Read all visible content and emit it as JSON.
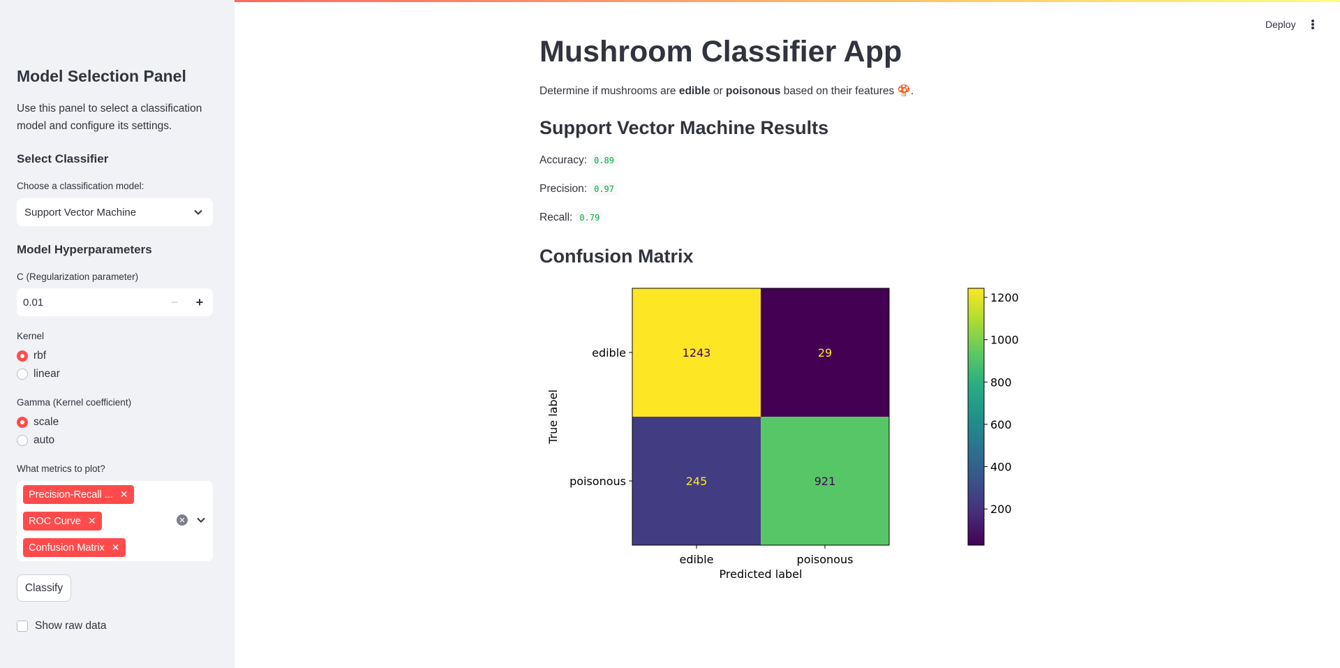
{
  "sidebar": {
    "title": "Model Selection Panel",
    "description": "Use this panel to select a classification model and configure its settings.",
    "select_classifier_heading": "Select Classifier",
    "model_label": "Choose a classification model:",
    "model_value": "Support Vector Machine",
    "hyperparams_heading": "Model Hyperparameters",
    "c_label": "C (Regularization parameter)",
    "c_value": "0.01",
    "kernel_label": "Kernel",
    "kernel_options": [
      "rbf",
      "linear"
    ],
    "kernel_selected": "rbf",
    "gamma_label": "Gamma (Kernel coefficient)",
    "gamma_options": [
      "scale",
      "auto"
    ],
    "gamma_selected": "scale",
    "metrics_label": "What metrics to plot?",
    "metrics_selected": [
      "Precision-Recall ...",
      "ROC Curve",
      "Confusion Matrix"
    ],
    "classify_button": "Classify",
    "raw_data_label": "Show raw data"
  },
  "header": {
    "deploy_label": "Deploy"
  },
  "main": {
    "title": "Mushroom Classifier App",
    "intro_prefix": "Determine if mushrooms are ",
    "intro_edible": "edible",
    "intro_or": " or ",
    "intro_poisonous": "poisonous",
    "intro_suffix": " based on their features",
    "intro_emoji": "🍄",
    "intro_end": ".",
    "results_heading": "Support Vector Machine Results",
    "metrics": [
      {
        "label": "Accuracy:",
        "value": "0.89"
      },
      {
        "label": "Precision:",
        "value": "0.97"
      },
      {
        "label": "Recall:",
        "value": "0.79"
      }
    ],
    "cm_heading": "Confusion Matrix"
  },
  "colors": {
    "accent": "#ff4b4b",
    "metric_value": "#09ab3b"
  },
  "chart_data": {
    "type": "heatmap",
    "rows": [
      "edible",
      "poisonous"
    ],
    "cols": [
      "edible",
      "poisonous"
    ],
    "values": [
      [
        1243,
        29
      ],
      [
        245,
        921
      ]
    ],
    "xlabel": "Predicted label",
    "ylabel": "True label",
    "colormap": "viridis",
    "colorbar_ticks": [
      200,
      400,
      600,
      800,
      1000,
      1200
    ],
    "colorbar_range": [
      29,
      1243
    ]
  }
}
